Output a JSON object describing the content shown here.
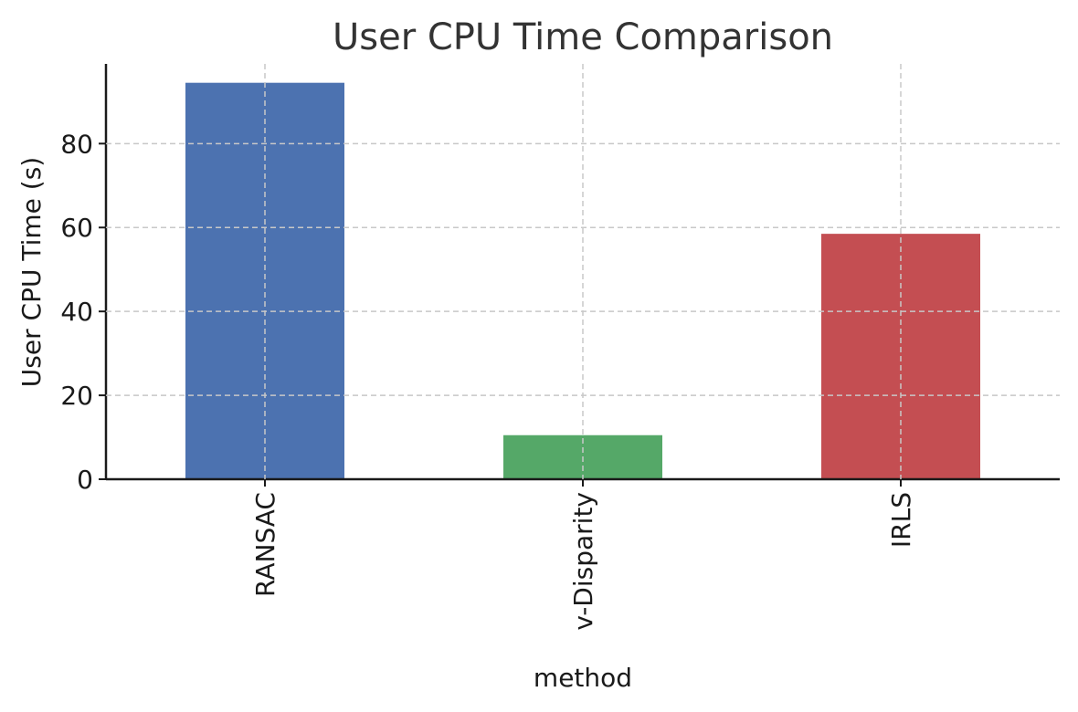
{
  "chart_data": {
    "type": "bar",
    "title": "User CPU Time Comparison",
    "xlabel": "method",
    "ylabel": "User CPU Time (s)",
    "categories": [
      "RANSAC",
      "v-Disparity",
      "IRLS"
    ],
    "values": [
      94.5,
      10.5,
      58.5
    ],
    "colors": [
      "#4c72b0",
      "#55a868",
      "#c44e52"
    ],
    "ylim": [
      0,
      99
    ],
    "yticks": [
      0,
      20,
      40,
      60,
      80
    ],
    "grid": true,
    "legend": "none"
  }
}
